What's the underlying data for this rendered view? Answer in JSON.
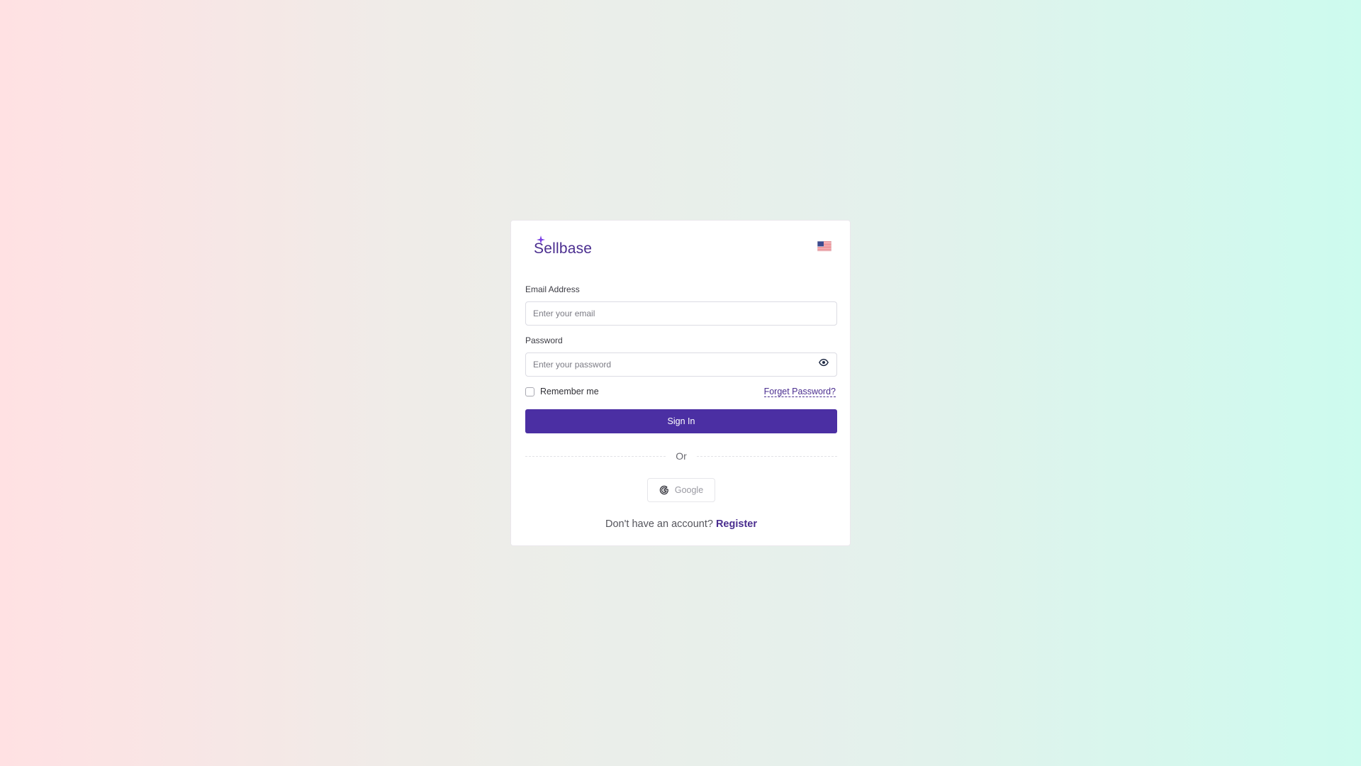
{
  "brand": {
    "name": "Sellbase",
    "color": "#4a2d8f",
    "spark_color": "#7b3fe4"
  },
  "language": {
    "flag_icon": "us-flag-icon"
  },
  "form": {
    "email_label": "Email Address",
    "email_placeholder": "Enter your email",
    "email_value": "",
    "password_label": "Password",
    "password_placeholder": "Enter your password",
    "password_value": "",
    "show_password_icon": "eye-icon",
    "remember_label": "Remember me",
    "remember_checked": false,
    "forgot_label": "Forget Password?",
    "submit_label": "Sign In",
    "submit_color": "#4b2fa3"
  },
  "divider": {
    "label": "Or"
  },
  "social": {
    "google_label": "Google",
    "google_icon": "google-g-icon"
  },
  "footer": {
    "prompt": "Don't have an account?",
    "register_label": "Register"
  }
}
